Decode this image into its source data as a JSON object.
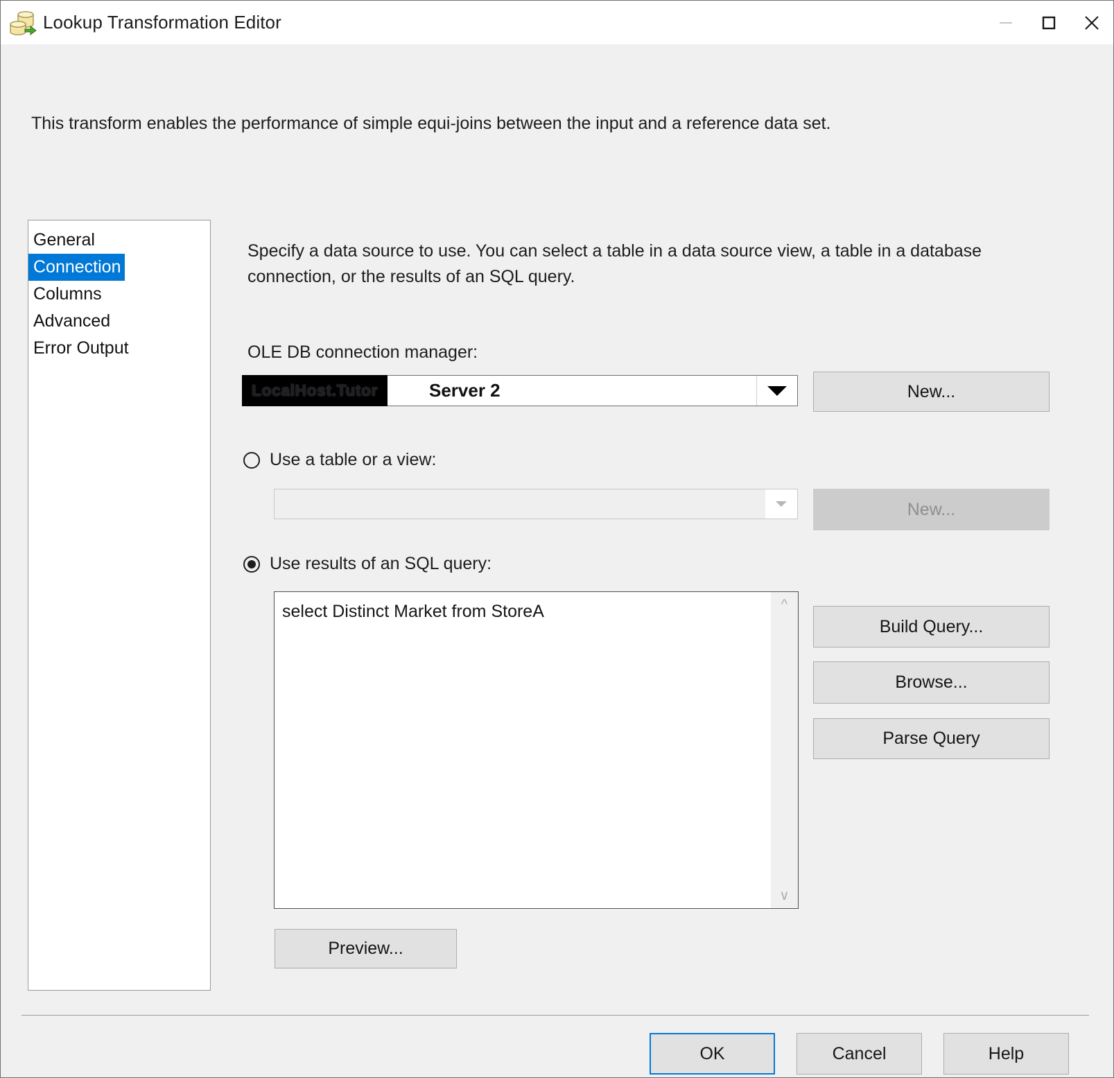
{
  "window": {
    "title": "Lookup Transformation Editor",
    "icon": "lookup-transformation-icon",
    "minimize_label": "—",
    "maximize_label": "☐",
    "close_label": "✕"
  },
  "intro": "This transform enables the performance of simple equi-joins between the input and a reference data set.",
  "sidebar": {
    "items": [
      {
        "label": "General",
        "selected": false
      },
      {
        "label": "Connection",
        "selected": true
      },
      {
        "label": "Columns",
        "selected": false
      },
      {
        "label": "Advanced",
        "selected": false
      },
      {
        "label": "Error Output",
        "selected": false
      }
    ],
    "selection_color": "#0078d7"
  },
  "pane": {
    "description": "Specify a data source to use. You can select a table in a data source view, a table in a database connection, or the results of an SQL query.",
    "connection_manager": {
      "label": "OLE DB connection manager:",
      "redacted_value": "LocalHost.Tutor",
      "value": "Server 2",
      "new_button": "New..."
    },
    "table_option": {
      "label": "Use a table or a view:",
      "selected": false,
      "value": "",
      "new_button": "New...",
      "new_button_disabled": true
    },
    "sql_option": {
      "label": "Use results of an SQL query:",
      "selected": true,
      "query": "select Distinct Market from StoreA",
      "build_query_button": "Build Query...",
      "browse_button": "Browse...",
      "parse_query_button": "Parse Query",
      "preview_button": "Preview...",
      "scroll_up_icon": "chevron-up-icon",
      "scroll_down_icon": "chevron-down-icon"
    }
  },
  "footer": {
    "ok": "OK",
    "cancel": "Cancel",
    "help": "Help",
    "default_button_outline": "#0078d7"
  }
}
